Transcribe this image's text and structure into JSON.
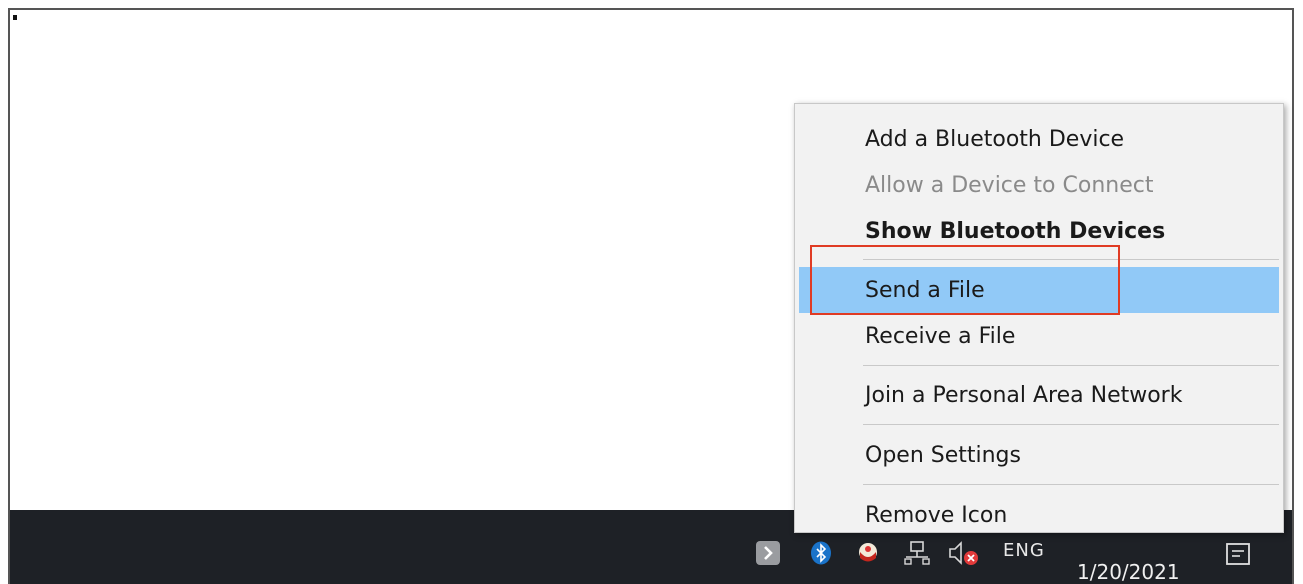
{
  "context_menu": {
    "items": [
      {
        "label": "Add a Bluetooth Device",
        "state": "normal"
      },
      {
        "label": "Allow a Device to Connect",
        "state": "disabled"
      },
      {
        "label": "Show Bluetooth Devices",
        "state": "bold"
      },
      {
        "label": "Send a File",
        "state": "highlighted"
      },
      {
        "label": "Receive a File",
        "state": "normal"
      },
      {
        "label": "Join a Personal Area Network",
        "state": "normal"
      },
      {
        "label": "Open Settings",
        "state": "normal"
      },
      {
        "label": "Remove Icon",
        "state": "normal"
      }
    ],
    "highlight_color": "#91c9f7",
    "annotation_color": "#e03b24"
  },
  "taskbar": {
    "language": "ENG",
    "date": "1/20/2021",
    "background_color": "#1e2126",
    "icons": [
      "show-hidden-icons-chevron-icon",
      "bluetooth-icon",
      "app-tray-icon",
      "network-icon",
      "volume-muted-icon",
      "action-center-icon"
    ]
  }
}
